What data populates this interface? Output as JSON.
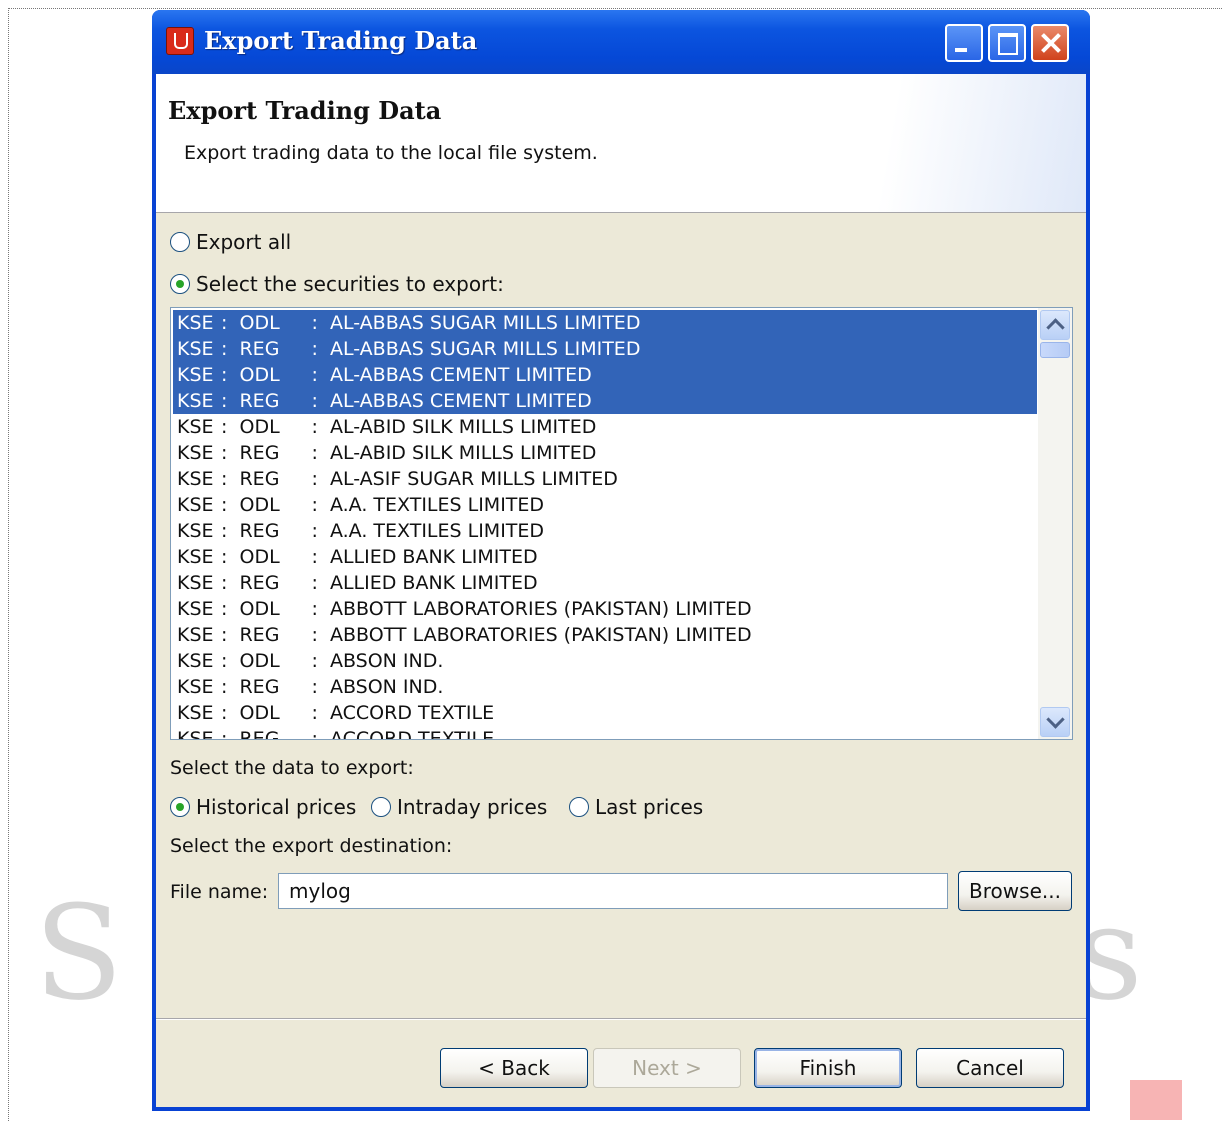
{
  "window": {
    "title": "Export Trading Data"
  },
  "banner": {
    "title": "Export Trading Data",
    "description": "Export trading data to the local file system."
  },
  "selection_mode": {
    "export_all_label": "Export all",
    "select_label": "Select the securities to export:",
    "selected": "select"
  },
  "securities": [
    {
      "exchange": "KSE",
      "market": "ODL",
      "name": "AL-ABBAS SUGAR MILLS LIMITED",
      "selected": true
    },
    {
      "exchange": "KSE",
      "market": "REG",
      "name": "AL-ABBAS SUGAR MILLS LIMITED",
      "selected": true
    },
    {
      "exchange": "KSE",
      "market": "ODL",
      "name": "AL-ABBAS CEMENT LIMITED",
      "selected": true
    },
    {
      "exchange": "KSE",
      "market": "REG",
      "name": "AL-ABBAS CEMENT LIMITED",
      "selected": true
    },
    {
      "exchange": "KSE",
      "market": "ODL",
      "name": "AL-ABID SILK MILLS LIMITED",
      "selected": false
    },
    {
      "exchange": "KSE",
      "market": "REG",
      "name": "AL-ABID SILK MILLS LIMITED",
      "selected": false
    },
    {
      "exchange": "KSE",
      "market": "REG",
      "name": "AL-ASIF SUGAR MILLS LIMITED",
      "selected": false
    },
    {
      "exchange": "KSE",
      "market": "ODL",
      "name": "A.A. TEXTILES LIMITED",
      "selected": false
    },
    {
      "exchange": "KSE",
      "market": "REG",
      "name": "A.A. TEXTILES LIMITED",
      "selected": false
    },
    {
      "exchange": "KSE",
      "market": "ODL",
      "name": "ALLIED BANK LIMITED",
      "selected": false
    },
    {
      "exchange": "KSE",
      "market": "REG",
      "name": "ALLIED BANK LIMITED",
      "selected": false
    },
    {
      "exchange": "KSE",
      "market": "ODL",
      "name": "ABBOTT LABORATORIES (PAKISTAN) LIMITED",
      "selected": false
    },
    {
      "exchange": "KSE",
      "market": "REG",
      "name": "ABBOTT LABORATORIES (PAKISTAN) LIMITED",
      "selected": false
    },
    {
      "exchange": "KSE",
      "market": "ODL",
      "name": "ABSON IND.",
      "selected": false
    },
    {
      "exchange": "KSE",
      "market": "REG",
      "name": "ABSON IND.",
      "selected": false
    },
    {
      "exchange": "KSE",
      "market": "ODL",
      "name": "ACCORD TEXTILE",
      "selected": false
    },
    {
      "exchange": "KSE",
      "market": "REG",
      "name": "ACCORD TEXTILE",
      "selected": false
    }
  ],
  "data_type": {
    "label": "Select the data to export:",
    "historical_label": "Historical prices",
    "intraday_label": "Intraday prices",
    "last_label": "Last prices",
    "selected": "historical"
  },
  "destination": {
    "label": "Select the export destination:",
    "file_label": "File name:",
    "file_value": "mylog",
    "browse_label": "Browse..."
  },
  "buttons": {
    "back": "< Back",
    "next": "Next >",
    "finish": "Finish",
    "cancel": "Cancel"
  }
}
